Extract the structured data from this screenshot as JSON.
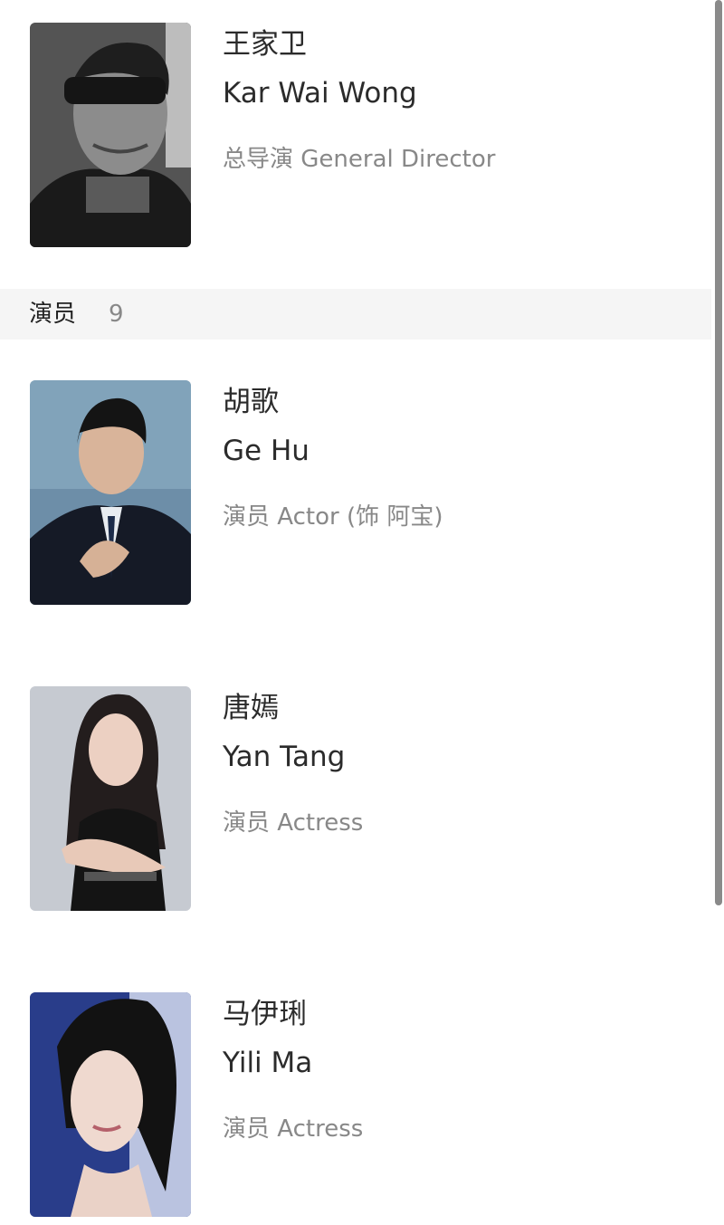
{
  "director": {
    "cn_name": "王家卫",
    "en_name": "Kar Wai Wong",
    "role": "总导演 General Director",
    "photo_icon": "portrait-photo"
  },
  "cast_section": {
    "title": "演员",
    "count": "9"
  },
  "cast": [
    {
      "cn_name": "胡歌",
      "en_name": "Ge Hu",
      "role": "演员 Actor (饰 阿宝)",
      "photo_icon": "portrait-photo"
    },
    {
      "cn_name": "唐嫣",
      "en_name": "Yan Tang",
      "role": "演员 Actress",
      "photo_icon": "portrait-photo"
    },
    {
      "cn_name": "马伊琍",
      "en_name": "Yili Ma",
      "role": "演员 Actress",
      "photo_icon": "portrait-photo"
    }
  ],
  "colors": {
    "background": "#ffffff",
    "section_header_bg": "#f5f5f5",
    "primary_text": "#2b2b2b",
    "secondary_text": "#888888"
  }
}
